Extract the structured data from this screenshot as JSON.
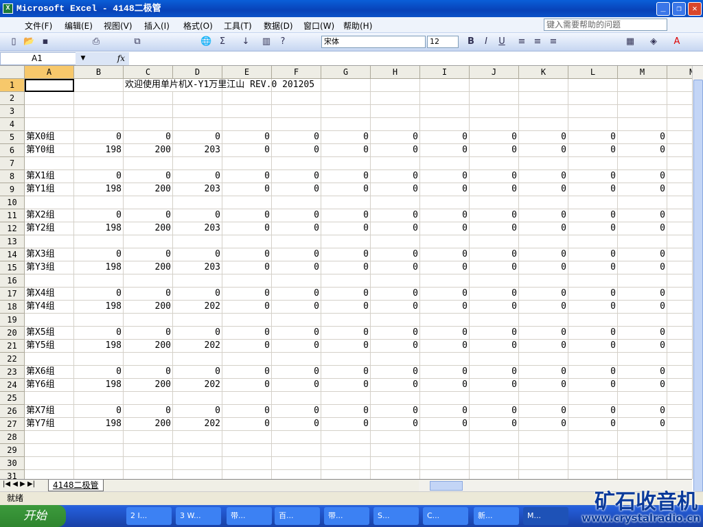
{
  "window": {
    "title": "Microsoft Excel - 4148二极管",
    "minimize": "_",
    "restore": "❐",
    "close": "✕"
  },
  "menu": {
    "items": [
      "文件(F)",
      "编辑(E)",
      "视图(V)",
      "插入(I)",
      "格式(O)",
      "工具(T)",
      "数据(D)",
      "窗口(W)",
      "帮助(H)"
    ],
    "help_placeholder": "键入需要帮助的问题"
  },
  "toolbar": {
    "font": "宋体",
    "size": "12",
    "bold": "B",
    "italic": "I",
    "underline": "U",
    "sum": "Σ"
  },
  "formula_bar": {
    "name_box": "A1",
    "fx": "fx",
    "value": ""
  },
  "columns": [
    "A",
    "B",
    "C",
    "D",
    "E",
    "F",
    "G",
    "H",
    "I",
    "J",
    "K",
    "L",
    "M",
    "N"
  ],
  "rows": [
    {
      "n": 1,
      "A": "",
      "title": "欢迎使用单片机X-Y1万里江山  REV.0 201205"
    },
    {
      "n": 2
    },
    {
      "n": 3
    },
    {
      "n": 4
    },
    {
      "n": 5,
      "A": "第X0组",
      "v": [
        0,
        0,
        0,
        0,
        0,
        0,
        0,
        0,
        0,
        0,
        0,
        0
      ]
    },
    {
      "n": 6,
      "A": "第Y0组",
      "v": [
        198,
        200,
        203,
        0,
        0,
        0,
        0,
        0,
        0,
        0,
        0,
        0
      ]
    },
    {
      "n": 7
    },
    {
      "n": 8,
      "A": "第X1组",
      "v": [
        0,
        0,
        0,
        0,
        0,
        0,
        0,
        0,
        0,
        0,
        0,
        0
      ]
    },
    {
      "n": 9,
      "A": "第Y1组",
      "v": [
        198,
        200,
        203,
        0,
        0,
        0,
        0,
        0,
        0,
        0,
        0,
        0
      ]
    },
    {
      "n": 10
    },
    {
      "n": 11,
      "A": "第X2组",
      "v": [
        0,
        0,
        0,
        0,
        0,
        0,
        0,
        0,
        0,
        0,
        0,
        0
      ]
    },
    {
      "n": 12,
      "A": "第Y2组",
      "v": [
        198,
        200,
        203,
        0,
        0,
        0,
        0,
        0,
        0,
        0,
        0,
        0
      ]
    },
    {
      "n": 13
    },
    {
      "n": 14,
      "A": "第X3组",
      "v": [
        0,
        0,
        0,
        0,
        0,
        0,
        0,
        0,
        0,
        0,
        0,
        0
      ]
    },
    {
      "n": 15,
      "A": "第Y3组",
      "v": [
        198,
        200,
        203,
        0,
        0,
        0,
        0,
        0,
        0,
        0,
        0,
        0
      ]
    },
    {
      "n": 16
    },
    {
      "n": 17,
      "A": "第X4组",
      "v": [
        0,
        0,
        0,
        0,
        0,
        0,
        0,
        0,
        0,
        0,
        0,
        0
      ]
    },
    {
      "n": 18,
      "A": "第Y4组",
      "v": [
        198,
        200,
        202,
        0,
        0,
        0,
        0,
        0,
        0,
        0,
        0,
        0
      ]
    },
    {
      "n": 19
    },
    {
      "n": 20,
      "A": "第X5组",
      "v": [
        0,
        0,
        0,
        0,
        0,
        0,
        0,
        0,
        0,
        0,
        0,
        0
      ]
    },
    {
      "n": 21,
      "A": "第Y5组",
      "v": [
        198,
        200,
        202,
        0,
        0,
        0,
        0,
        0,
        0,
        0,
        0,
        0
      ]
    },
    {
      "n": 22
    },
    {
      "n": 23,
      "A": "第X6组",
      "v": [
        0,
        0,
        0,
        0,
        0,
        0,
        0,
        0,
        0,
        0,
        0,
        0
      ]
    },
    {
      "n": 24,
      "A": "第Y6组",
      "v": [
        198,
        200,
        202,
        0,
        0,
        0,
        0,
        0,
        0,
        0,
        0,
        0
      ]
    },
    {
      "n": 25
    },
    {
      "n": 26,
      "A": "第X7组",
      "v": [
        0,
        0,
        0,
        0,
        0,
        0,
        0,
        0,
        0,
        0,
        0,
        0
      ]
    },
    {
      "n": 27,
      "A": "第Y7组",
      "v": [
        198,
        200,
        202,
        0,
        0,
        0,
        0,
        0,
        0,
        0,
        0,
        0
      ]
    },
    {
      "n": 28
    },
    {
      "n": 29
    },
    {
      "n": 30
    },
    {
      "n": 31
    }
  ],
  "sheet_tab": "4148二极管",
  "status": "就绪",
  "taskbar": {
    "start": "开始",
    "tasks": [
      "2 I...",
      "3 W...",
      "带...",
      "百...",
      "带...",
      "S...",
      "C...",
      "新...",
      "M..."
    ]
  },
  "watermark": {
    "text": "矿石收音机",
    "url": "www.crystalradio.cn"
  }
}
